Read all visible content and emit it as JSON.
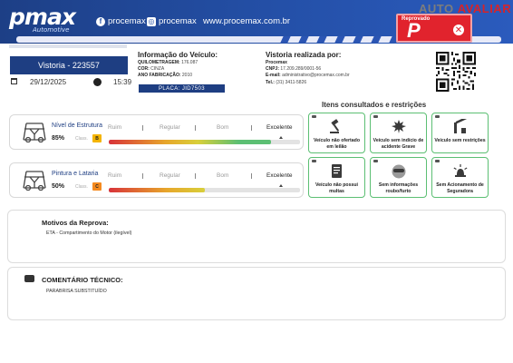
{
  "header": {
    "logo_main": "pmax",
    "logo_sub": "Automotive",
    "facebook_handle": "procemax",
    "instagram_handle": "procemax",
    "website": "www.procemax.com.br",
    "brand_auto": "AUTO",
    "brand_avaliar": "AVALIAR",
    "stamp_label": "Reprovado",
    "stamp_letter": "P",
    "colors": {
      "primary": "#1e3e82",
      "stamp": "#e1232d",
      "ok": "#5cbf73"
    }
  },
  "vistoria": {
    "title": "Vistoria - 223557",
    "date": "29/12/2025",
    "time": "15:39"
  },
  "vehicle_info": {
    "title": "Informação do Veículo:",
    "km_label": "QUILOMETRAGEM:",
    "km_value": "176.087",
    "color_label": "COR:",
    "color_value": "CINZA",
    "year_label": "ANO FABRICAÇÃO:",
    "year_value": "2010",
    "plate": "PLACA: JID7503"
  },
  "inspector": {
    "title": "Vistoria realizada por:",
    "company": "Procemax",
    "cnpj_label": "CNPJ:",
    "cnpj_value": "17.209.289/0001-56",
    "email_label": "E-mail:",
    "email_value": "administrativo@procemax.com.br",
    "tel_label": "Tel.:",
    "tel_value": "(31) 3411-5826"
  },
  "ratings": [
    {
      "title": "Nível de Estrutura",
      "percent": "85%",
      "class_label": "Class.",
      "class_value": "B",
      "badge_color": "#f4b400",
      "fill_fraction": 0.85,
      "scale": [
        "Ruim",
        "Regular",
        "Bom",
        "Excelente"
      ]
    },
    {
      "title": "Pintura e Lataria",
      "percent": "50%",
      "class_label": "Class.",
      "class_value": "C",
      "badge_color": "#f58a1f",
      "fill_fraction": 0.5,
      "scale": [
        "Ruim",
        "Regular",
        "Bom",
        "Excelente"
      ]
    }
  ],
  "restrictions": {
    "title": "Itens consultados e restrições",
    "items": [
      {
        "label": "Veículo não ofertado em leilão",
        "icon": "gavel-icon"
      },
      {
        "label": "Veículo sem indício de acidente Grave",
        "icon": "crash-icon"
      },
      {
        "label": "Veículo sem restrições",
        "icon": "barrier-icon"
      },
      {
        "label": "Veículo não possui multas",
        "icon": "document-icon"
      },
      {
        "label": "Sem informações roubo/furto",
        "icon": "mask-icon"
      },
      {
        "label": "Sem Acionamento de Seguradora",
        "icon": "alarm-icon"
      }
    ]
  },
  "reprova": {
    "title": "Motivos da Reprova:",
    "text": "ETA - Compartimento do Motor (ilegível)"
  },
  "comment": {
    "title": "COMENTÁRIO TÉCNICO:",
    "text": "PARABRISA SUBSTITUÍDO"
  }
}
